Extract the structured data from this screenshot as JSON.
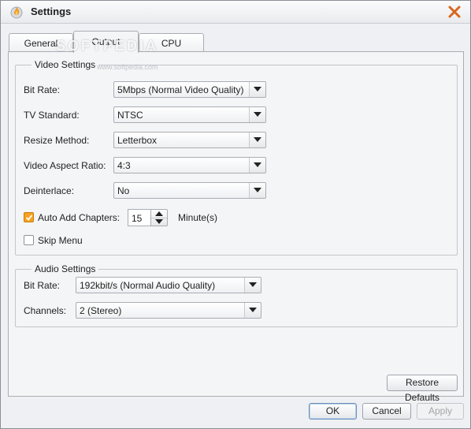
{
  "window": {
    "title": "Settings",
    "icons": {
      "app": "flame-app-icon",
      "close": "close-x-icon"
    },
    "colors": {
      "close_icon": "#d9661e",
      "checkbox_checked": "#f6a21f",
      "frame": "#eef0f3"
    }
  },
  "tabs": [
    {
      "label": "General",
      "active": false
    },
    {
      "label": "Output",
      "active": true
    },
    {
      "label": "CPU",
      "active": false
    }
  ],
  "watermark": {
    "text": "SOFTPEDIA",
    "url": "www.softpedia.com"
  },
  "video_settings": {
    "legend": "Video Settings",
    "bit_rate": {
      "label": "Bit Rate:",
      "value": "5Mbps (Normal Video Quality)"
    },
    "tv_standard": {
      "label": "TV Standard:",
      "value": "NTSC"
    },
    "resize_method": {
      "label": "Resize Method:",
      "value": "Letterbox"
    },
    "aspect_ratio": {
      "label": "Video Aspect Ratio:",
      "value": "4:3"
    },
    "deinterlace": {
      "label": "Deinterlace:",
      "value": "No"
    },
    "auto_add_chapters": {
      "label": "Auto Add Chapters:",
      "checked": true,
      "value": "15",
      "unit": "Minute(s)"
    },
    "skip_menu": {
      "label": "Skip Menu",
      "checked": false
    }
  },
  "audio_settings": {
    "legend": "Audio Settings",
    "bit_rate": {
      "label": "Bit Rate:",
      "value": "192kbit/s (Normal Audio Quality)"
    },
    "channels": {
      "label": "Channels:",
      "value": "2 (Stereo)"
    }
  },
  "buttons": {
    "restore_defaults": "Restore Defaults",
    "ok": "OK",
    "cancel": "Cancel",
    "apply": "Apply"
  }
}
